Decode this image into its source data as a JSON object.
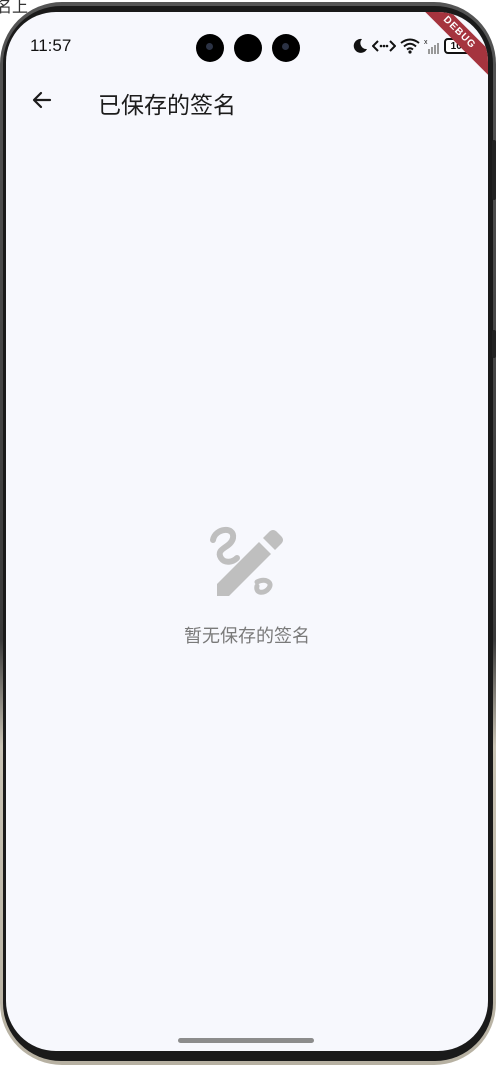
{
  "browser_strip": {
    "text": "名上"
  },
  "status_bar": {
    "time": "11:57",
    "battery": "100",
    "icons": [
      "moon-icon",
      "data-transfer-icon",
      "wifi-icon",
      "signal-icon",
      "battery-icon"
    ]
  },
  "debug_banner": {
    "label": "DEBUG"
  },
  "app_bar": {
    "back_icon": "arrow-left-icon",
    "title": "已保存的签名"
  },
  "empty_state": {
    "icon": "signature-icon",
    "message": "暂无保存的签名"
  },
  "colors": {
    "screen_background": "#f7f8fd",
    "debug_ribbon": "#a5343e",
    "empty_icon": "#bfbfbf",
    "empty_text": "#7a7a7a"
  }
}
